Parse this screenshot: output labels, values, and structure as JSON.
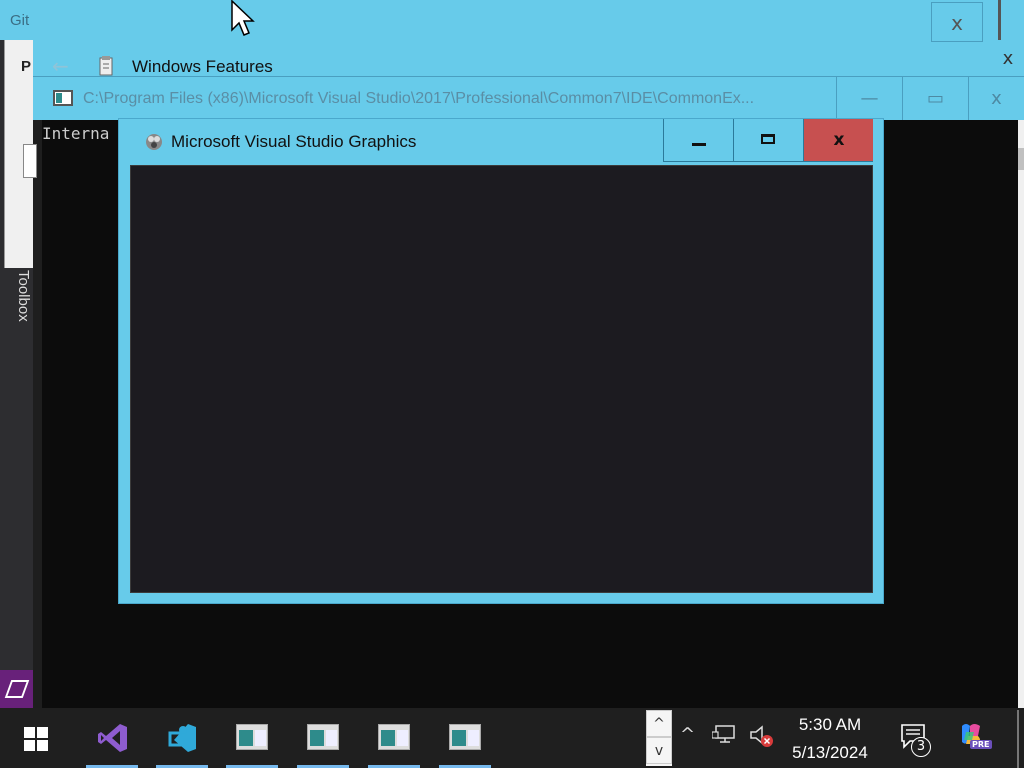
{
  "background_app": {
    "tab_label": "Git",
    "panel_letter": "P",
    "toolbox_label": "Toolbox"
  },
  "windows_features": {
    "title": "Windows Features",
    "close_label": "x",
    "secondary_close_label": "x"
  },
  "console": {
    "title_path": "C:\\Program Files (x86)\\Microsoft Visual Studio\\2017\\Professional\\Common7\\IDE\\CommonEx...",
    "output_text": "Interna",
    "minimize_label": "—",
    "maximize_label": "▭",
    "close_label": "x"
  },
  "vs_graphics_dialog": {
    "title": "Microsoft Visual Studio Graphics",
    "close_label": "x"
  },
  "taskbar": {
    "items": [
      {
        "name": "start",
        "icon": "windows-logo-icon"
      },
      {
        "name": "visual-studio",
        "icon": "visual-studio-icon"
      },
      {
        "name": "vs-installer",
        "icon": "vs-installer-icon"
      },
      {
        "name": "window-1",
        "icon": "app-window-icon"
      },
      {
        "name": "window-2",
        "icon": "app-window-icon"
      },
      {
        "name": "window-3",
        "icon": "app-window-icon"
      },
      {
        "name": "window-4",
        "icon": "app-window-icon"
      }
    ],
    "tray": {
      "scroll_up": "^",
      "scroll_down": "v",
      "chevron": "^",
      "time": "5:30 AM",
      "date": "5/13/2024",
      "notification_count": "3",
      "copilot_badge": "PRE"
    }
  },
  "colors": {
    "window_chrome": "#67cbea",
    "close_button": "#c75050",
    "console_bg": "#0c0c0c",
    "canvas_bg": "#1c1b20",
    "taskbar_bg": "#1f1f1f"
  }
}
